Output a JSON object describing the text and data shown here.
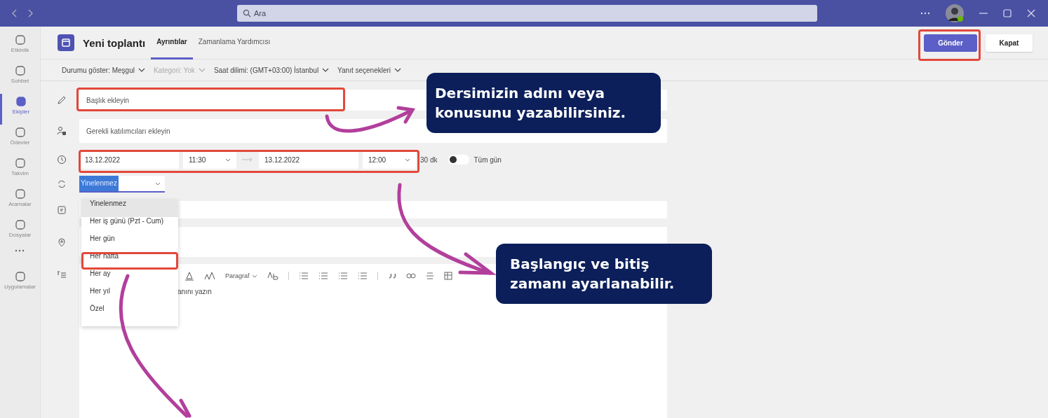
{
  "title_bar": {
    "search_placeholder": "Ara"
  },
  "rail": [
    {
      "label": "Etkinlik",
      "selected": false
    },
    {
      "label": "Sohbet",
      "selected": false
    },
    {
      "label": "Ekipler",
      "selected": true
    },
    {
      "label": "Ödevler",
      "selected": false
    },
    {
      "label": "Takvim",
      "selected": false
    },
    {
      "label": "Aramalar",
      "selected": false
    },
    {
      "label": "Dosyalar",
      "selected": false
    },
    {
      "label": "Uygulamalar",
      "selected": false
    }
  ],
  "header": {
    "title": "Yeni toplantı",
    "tabs": [
      {
        "label": "Ayrıntılar",
        "selected": true
      },
      {
        "label": "Zamanlama Yardımcısı",
        "selected": false
      }
    ],
    "buttons": [
      {
        "label": "Gönder",
        "kind": "primary"
      },
      {
        "label": "Kapat",
        "kind": "secondary"
      }
    ]
  },
  "options": [
    {
      "label": "Durumu göster: Meşgul",
      "disabled": false
    },
    {
      "label": "Kategori: Yok",
      "disabled": true
    },
    {
      "label": "Saat dilimi: (GMT+03:00) İstanbul",
      "disabled": false
    },
    {
      "label": "Yanıt seçenekleri",
      "disabled": false
    }
  ],
  "form": {
    "title_placeholder": "Başlık ekleyin",
    "attendees_placeholder": "Gerekli katılımcıları ekleyin",
    "start_date": "13.12.2022",
    "start_time": "11:30",
    "end_date": "13.12.2022",
    "end_time": "12:00",
    "duration": "30 dk",
    "all_day": {
      "label": "Tüm gün",
      "on": false
    },
    "recurrence": "Yinelenmez"
  },
  "recurrence_menu": [
    {
      "label": "Yinelenmez",
      "selected": true,
      "highlighted": false
    },
    {
      "label": "Her iş günü (Pzt - Cum)",
      "selected": false,
      "highlighted": false
    },
    {
      "label": "Her gün",
      "selected": false,
      "highlighted": false
    },
    {
      "label": "Her hafta",
      "selected": false,
      "highlighted": true
    },
    {
      "label": "Her ay",
      "selected": false,
      "highlighted": false
    },
    {
      "label": "Her yıl",
      "selected": false,
      "highlighted": false
    },
    {
      "label": "Özel",
      "selected": false,
      "highlighted": false
    }
  ],
  "editor": {
    "paragraph_style": "Paragraf",
    "placeholder_fragment": "anını yazın"
  },
  "callouts": [
    {
      "lines": [
        "Dersimizin adını veya",
        "konusunu yazabilirsiniz."
      ]
    },
    {
      "lines": [
        "Başlangıç ve bitiş",
        "zamanı ayarlanabilir."
      ]
    }
  ]
}
